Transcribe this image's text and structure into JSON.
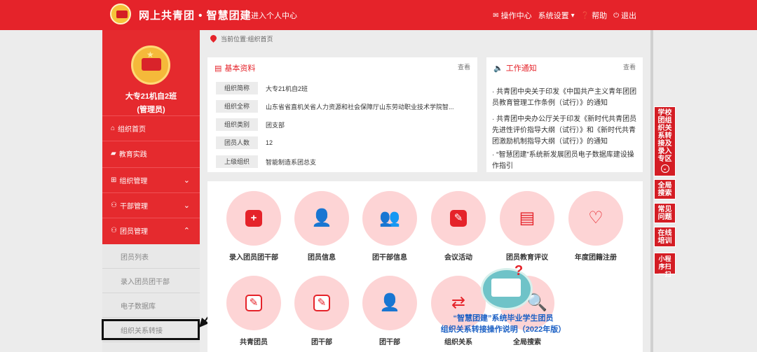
{
  "header": {
    "title": "网上共青团 • 智慧团建",
    "personal_center": "进入个人中心",
    "nav": {
      "ops": "操作中心",
      "settings": "系统设置",
      "help": "帮助",
      "logout": "退出"
    }
  },
  "sidebar": {
    "org_name": "大专21机自2班",
    "role": "(管理员)",
    "menu": {
      "home": "组织首页",
      "edu": "教育实践",
      "org_mgmt": "组织管理",
      "cadre_mgmt": "干部管理",
      "member_mgmt": "团员管理"
    },
    "submenu": {
      "list": "团员列表",
      "enter_cadre": "录入团员团干部",
      "archive": "电子数据库",
      "transfer": "组织关系转接"
    }
  },
  "breadcrumb": "当前位置:组织首页",
  "basic_info": {
    "title": "基本资料",
    "more": "查看",
    "rows": [
      {
        "label": "组织简称",
        "value": "大专21机自2班"
      },
      {
        "label": "组织全称",
        "value": "山东省省直机关省人力资源和社会保障厅山东劳动职业技术学院智..."
      },
      {
        "label": "组织类别",
        "value": "团支部"
      },
      {
        "label": "团员人数",
        "value": "12"
      },
      {
        "label": "上级组织",
        "value": "智能制造系团总支"
      }
    ]
  },
  "work_notice": {
    "title": "工作通知",
    "more": "查看",
    "items": [
      "· 共青团中央关于印发《中国共产主义青年团团员教育管理工作条例（试行）》的通知",
      "· 共青团中央办公厅关于印发《新时代共青团员先进性评价指导大纲（试行）》和《新时代共青团激励机制指导大纲（试行）》的通知",
      "· “智慧团建”系统新发展团员电子数据库建设操作指引"
    ]
  },
  "functions": {
    "row1": [
      {
        "label": "录入团员团干部",
        "icon": "plus-icon"
      },
      {
        "label": "团员信息",
        "icon": "person-icon"
      },
      {
        "label": "团干部信息",
        "icon": "group-icon"
      },
      {
        "label": "会议活动",
        "icon": "edit-icon"
      },
      {
        "label": "团员教育评议",
        "icon": "document-icon"
      },
      {
        "label": "年度团籍注册",
        "icon": "heart-icon"
      }
    ],
    "row2": [
      {
        "label": "共青团员",
        "icon": "edit-icon"
      },
      {
        "label": "团干部",
        "icon": "edit-icon"
      },
      {
        "label": "团干部",
        "icon": "person-icon"
      },
      {
        "label": "组织关系",
        "icon": "transfer-icon"
      },
      {
        "label": "全局搜索",
        "icon": "search-icon"
      }
    ]
  },
  "overlay": {
    "line1": "“智慧团建”系统毕业学生团员",
    "line2": "组织关系转接操作说明（2022年版）"
  },
  "float_tools": {
    "transfer_zone": "学校团组织关系转接及录入专区",
    "global_search": "全局搜索",
    "faq": "常见问题",
    "training": "在线培训",
    "mini_program": "小程序扫一扫"
  },
  "colors": {
    "brand_red": "#e5232a",
    "pink_circle": "#fdd4d5",
    "link_blue": "#1a5fc4"
  }
}
